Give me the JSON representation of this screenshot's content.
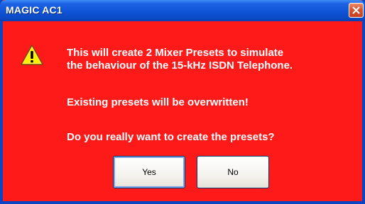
{
  "window": {
    "title": "MAGIC AC1"
  },
  "icons": {
    "warning": "warning-icon",
    "close": "close-icon"
  },
  "colors": {
    "dialog_background": "#ff1a1a",
    "titlebar": "#0f54d6",
    "close_button": "#d9532e"
  },
  "dialog": {
    "message_line1": "This will create 2 Mixer Presets to simulate",
    "message_line2": "the behaviour of the 15-kHz ISDN Telephone.",
    "message_line3": "Existing presets will be overwritten!",
    "message_line4": "Do you really want to create the presets?"
  },
  "buttons": {
    "yes_label": "Yes",
    "no_label": "No"
  }
}
